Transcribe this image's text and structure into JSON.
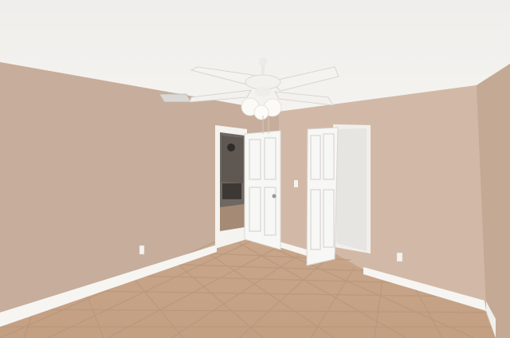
{
  "scene": {
    "kind": "photo",
    "subject": "empty-room",
    "colors": {
      "ceiling": "#f1f0ed",
      "wall_left": "#c8ae9c",
      "wall_back": "#d3baa8",
      "wall_right": "#c5aa96",
      "baseboard": "#f6f5f2",
      "door": "#f7f7f5",
      "floor_tile": "#c8a589",
      "grout": "#b79678",
      "fan": "#f4f3ef"
    }
  }
}
